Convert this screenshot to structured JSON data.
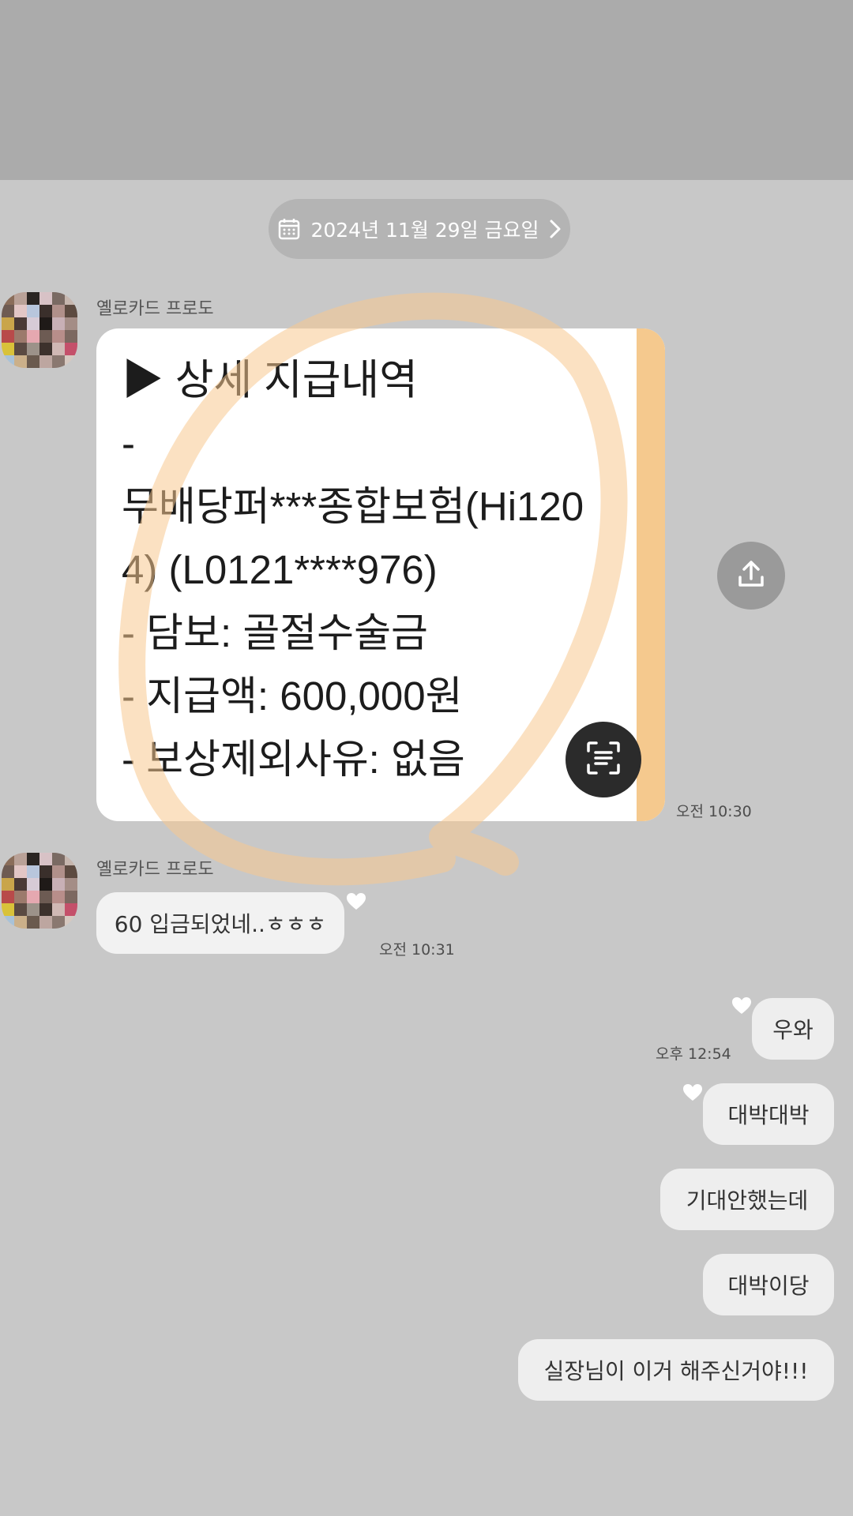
{
  "date_bar": {
    "label": "2024년 11월 29일 금요일"
  },
  "messages_in": [
    {
      "sender": "옐로카드 프로도",
      "time": "오전 10:30"
    },
    {
      "sender": "옐로카드 프로도",
      "text": "60 입금되었네..ㅎㅎㅎ",
      "time": "오전 10:31"
    }
  ],
  "card": {
    "lines": [
      "▶ 상세 지급내역",
      "-",
      "무배당퍼***종합보험(Hi120",
      "4) (L0121****976)",
      "- 담보: 골절수술금",
      "- 지급액: 600,000원",
      "- 보상제외사유: 없음"
    ]
  },
  "messages_out": [
    {
      "text": "우와",
      "time": "오후 12:54"
    },
    {
      "text": "대박대박"
    },
    {
      "text": "기대안했는데"
    },
    {
      "text": "대박이당"
    },
    {
      "text": "실장님이 이거 해주신거야!!!"
    }
  ],
  "icons": {
    "calendar": "calendar-icon",
    "chevron": "chevron-right-icon",
    "share": "share-icon",
    "scan": "text-scan-icon",
    "heart": "heart-icon"
  },
  "colors": {
    "background": "#c8c8c8",
    "top_bar": "#ababab",
    "card_strip": "#f5c98e",
    "circle_highlight": "#f8c890"
  }
}
